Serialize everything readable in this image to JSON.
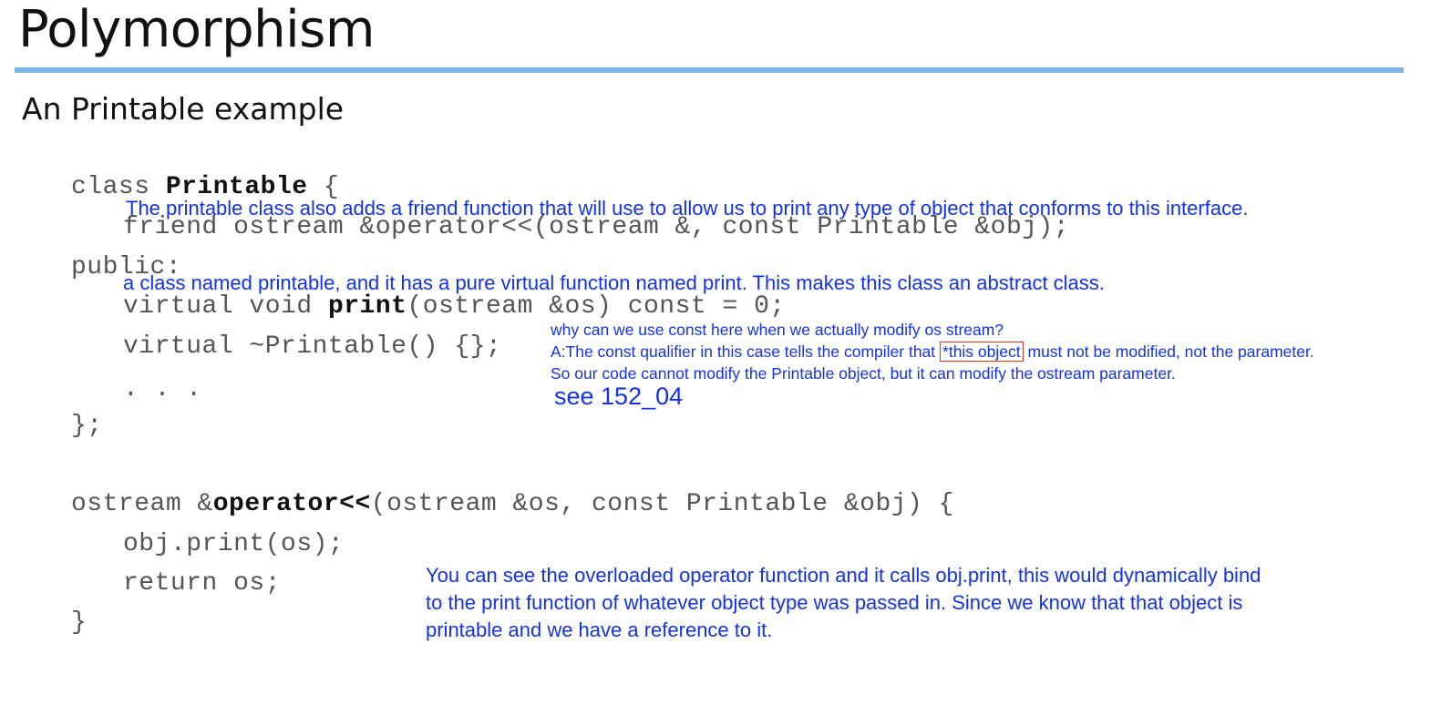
{
  "slide": {
    "title": "Polymorphism",
    "subtitle": "An Printable example"
  },
  "code": {
    "class_kw": "class ",
    "class_name": "Printable",
    "class_open": " {",
    "friend_line": "friend ostream &operator<<(ostream &, const Printable &obj);",
    "public_line": "public:",
    "print_pre": "virtual void ",
    "print_name": "print",
    "print_post": "(ostream &os) const = 0;",
    "dtor_line": "virtual ~Printable() {};",
    "ellipsis_line": ". . .",
    "class_close": "};",
    "op_pre": "ostream &",
    "op_name": "operator<<",
    "op_post": "(ostream &os, const Printable &obj) {",
    "call_line": "obj.print(os);",
    "return_line": "return os;",
    "fn_close": "}"
  },
  "notes": {
    "friend_note": "The printable class also adds a friend function that will use to allow us to print any type of object that conforms to this interface.",
    "class_note": "a class named printable, and it has a pure virtual function named print. This makes this class an abstract class.",
    "const_question": "why can we use const here when we actually modify os stream?",
    "const_answer_pre": "A:The const qualifier in this case tells the compiler that ",
    "const_answer_boxed": "*this object",
    "const_answer_post": " must not be modified, not the parameter.",
    "const_answer_line2": "So our code cannot modify the Printable object, but it can modify the ostream parameter.",
    "see_ref": "see 152_04",
    "operator_note_line1": "You can see the overloaded operator function and it calls obj.print, this would dynamically bind",
    "operator_note_line2": "to the print function of whatever object type was passed in. Since we know that that object is",
    "operator_note_line3": "printable and we have a reference to it."
  },
  "colors": {
    "accent_rule": "#7fb2e5",
    "annotation_blue": "#1432e6",
    "highlight_box": "#e0301e"
  }
}
